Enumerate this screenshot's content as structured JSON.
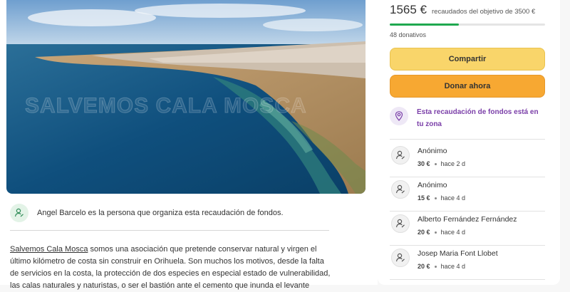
{
  "hero": {
    "watermark": "SALVEMOS CALA MOSCA"
  },
  "organizer": {
    "text": "Angel Barcelo es la persona que organiza esta recaudación de fondos."
  },
  "description": {
    "link": "Salvemos Cala Mosca",
    "text": " somos una asociación que pretende conservar natural y virgen el último kilómetro de costa sin construir en Orihuela. Son muchos los motivos, desde la falta de servicios en la costa, la protección de dos especies en especial estado de vulnerabilidad, las calas naturales y naturistas, o ser el bastión ante el cemento que inunda el levante"
  },
  "fundraiser": {
    "raised": "1565 €",
    "goal_text": "recaudados del objetivo de 3500 €",
    "progress": 0.447,
    "donors": "48 donativos",
    "share_label": "Compartir",
    "donate_label": "Donar ahora",
    "zone_text": "Esta recaudación de fondos está en tu zona"
  },
  "donations": [
    {
      "name": "Anónimo",
      "amount": "30 €",
      "time": "hace 2 d"
    },
    {
      "name": "Anónimo",
      "amount": "15 €",
      "time": "hace 4 d"
    },
    {
      "name": "Alberto Fernández Fernández",
      "amount": "20 €",
      "time": "hace 4 d"
    },
    {
      "name": "Josep Maria Font Llobet",
      "amount": "20 €",
      "time": "hace 4 d"
    }
  ],
  "colors": {
    "progress": "#1fa84f",
    "share": "#f9d56a",
    "donate": "#f7a832",
    "zone": "#7a3ea8"
  }
}
